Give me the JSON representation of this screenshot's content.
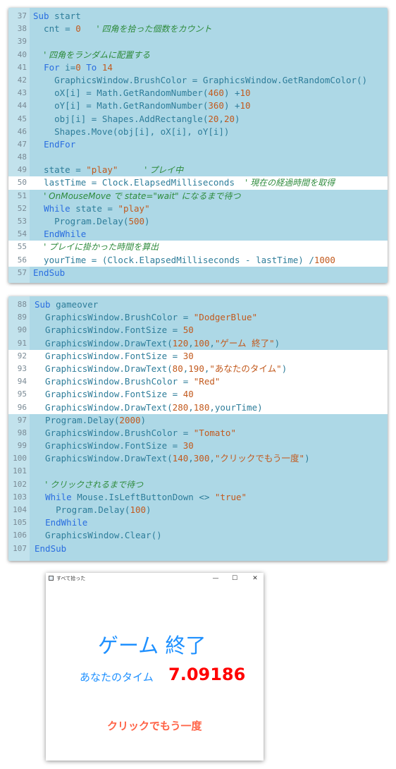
{
  "panel1": {
    "lines": [
      {
        "n": "37",
        "tokens": [
          [
            "kw",
            "Sub"
          ],
          [
            "id",
            " start"
          ]
        ]
      },
      {
        "n": "38",
        "tokens": [
          [
            "id",
            "  cnt = "
          ],
          [
            "num",
            "0"
          ],
          [
            "id",
            "   "
          ],
          [
            "cmt",
            "' 四角を拾った個数をカウント"
          ]
        ]
      },
      {
        "n": "39",
        "tokens": []
      },
      {
        "n": "40",
        "tokens": [
          [
            "id",
            "  "
          ],
          [
            "cmt",
            "' 四角をランダムに配置する"
          ]
        ]
      },
      {
        "n": "41",
        "tokens": [
          [
            "id",
            "  "
          ],
          [
            "kw",
            "For"
          ],
          [
            "id",
            " i="
          ],
          [
            "num",
            "0"
          ],
          [
            "id",
            " "
          ],
          [
            "kw",
            "To"
          ],
          [
            "id",
            " "
          ],
          [
            "num",
            "14"
          ]
        ]
      },
      {
        "n": "42",
        "tokens": [
          [
            "id",
            "    GraphicsWindow.BrushColor = GraphicsWindow.GetRandomColor()"
          ]
        ]
      },
      {
        "n": "43",
        "tokens": [
          [
            "id",
            "    oX[i] = Math.GetRandomNumber("
          ],
          [
            "num",
            "460"
          ],
          [
            "id",
            ") +"
          ],
          [
            "num",
            "10"
          ]
        ]
      },
      {
        "n": "44",
        "tokens": [
          [
            "id",
            "    oY[i] = Math.GetRandomNumber("
          ],
          [
            "num",
            "360"
          ],
          [
            "id",
            ") +"
          ],
          [
            "num",
            "10"
          ]
        ]
      },
      {
        "n": "45",
        "tokens": [
          [
            "id",
            "    obj[i] = Shapes.AddRectangle("
          ],
          [
            "num",
            "20"
          ],
          [
            "id",
            ","
          ],
          [
            "num",
            "20"
          ],
          [
            "id",
            ")"
          ]
        ]
      },
      {
        "n": "46",
        "tokens": [
          [
            "id",
            "    Shapes.Move(obj[i], oX[i], oY[i])"
          ]
        ]
      },
      {
        "n": "47",
        "tokens": [
          [
            "id",
            "  "
          ],
          [
            "kw",
            "EndFor"
          ]
        ]
      },
      {
        "n": "48",
        "tokens": []
      },
      {
        "n": "49",
        "tokens": [
          [
            "id",
            "  state = "
          ],
          [
            "str",
            "\"play\""
          ],
          [
            "id",
            "     "
          ],
          [
            "cmt",
            "' プレイ中"
          ]
        ]
      },
      {
        "n": "50",
        "hl": true,
        "tokens": [
          [
            "id",
            "  lastTime = Clock.ElapsedMilliseconds  "
          ],
          [
            "cmt",
            "' 現在の経過時間を取得"
          ]
        ]
      },
      {
        "n": "51",
        "tokens": [
          [
            "id",
            "  "
          ],
          [
            "cmt",
            "' OnMouseMove で state=\"wait\" になるまで待つ"
          ]
        ]
      },
      {
        "n": "52",
        "tokens": [
          [
            "id",
            "  "
          ],
          [
            "kw",
            "While"
          ],
          [
            "id",
            " state = "
          ],
          [
            "str",
            "\"play\""
          ]
        ]
      },
      {
        "n": "53",
        "tokens": [
          [
            "id",
            "    Program.Delay("
          ],
          [
            "num",
            "500"
          ],
          [
            "id",
            ")"
          ]
        ]
      },
      {
        "n": "54",
        "tokens": [
          [
            "id",
            "  "
          ],
          [
            "kw",
            "EndWhile"
          ]
        ]
      },
      {
        "n": "55",
        "hl": true,
        "tokens": [
          [
            "id",
            "  "
          ],
          [
            "cmt",
            "' プレイに掛かった時間を算出"
          ]
        ]
      },
      {
        "n": "56",
        "hl": true,
        "tokens": [
          [
            "id",
            "  yourTime = (Clock.ElapsedMilliseconds - lastTime) /"
          ],
          [
            "num",
            "1000"
          ]
        ]
      },
      {
        "n": "57",
        "tokens": [
          [
            "kw",
            "EndSub"
          ]
        ]
      }
    ]
  },
  "panel2": {
    "lines": [
      {
        "n": "88",
        "tokens": [
          [
            "kw",
            "Sub"
          ],
          [
            "id",
            " gameover"
          ]
        ]
      },
      {
        "n": "89",
        "tokens": [
          [
            "id",
            "  GraphicsWindow.BrushColor = "
          ],
          [
            "str",
            "\"DodgerBlue\""
          ]
        ]
      },
      {
        "n": "90",
        "tokens": [
          [
            "id",
            "  GraphicsWindow.FontSize = "
          ],
          [
            "num",
            "50"
          ]
        ]
      },
      {
        "n": "91",
        "tokens": [
          [
            "id",
            "  GraphicsWindow.DrawText("
          ],
          [
            "num",
            "120"
          ],
          [
            "id",
            ","
          ],
          [
            "num",
            "100"
          ],
          [
            "id",
            ","
          ],
          [
            "str",
            "\"ゲーム 終了\""
          ],
          [
            "id",
            ")"
          ]
        ]
      },
      {
        "n": "92",
        "hl": true,
        "tokens": [
          [
            "id",
            "  GraphicsWindow.FontSize = "
          ],
          [
            "num",
            "30"
          ]
        ]
      },
      {
        "n": "93",
        "hl": true,
        "tokens": [
          [
            "id",
            "  GraphicsWindow.DrawText("
          ],
          [
            "num",
            "80"
          ],
          [
            "id",
            ","
          ],
          [
            "num",
            "190"
          ],
          [
            "id",
            ","
          ],
          [
            "str",
            "\"あなたのタイム\""
          ],
          [
            "id",
            ")"
          ]
        ]
      },
      {
        "n": "94",
        "hl": true,
        "tokens": [
          [
            "id",
            "  GraphicsWindow.BrushColor = "
          ],
          [
            "str",
            "\"Red\""
          ]
        ]
      },
      {
        "n": "95",
        "hl": true,
        "tokens": [
          [
            "id",
            "  GraphicsWindow.FontSize = "
          ],
          [
            "num",
            "40"
          ]
        ]
      },
      {
        "n": "96",
        "hl": true,
        "tokens": [
          [
            "id",
            "  GraphicsWindow.DrawText("
          ],
          [
            "num",
            "280"
          ],
          [
            "id",
            ","
          ],
          [
            "num",
            "180"
          ],
          [
            "id",
            ",yourTime)"
          ]
        ]
      },
      {
        "n": "97",
        "tokens": [
          [
            "id",
            "  Program.Delay("
          ],
          [
            "num",
            "2000"
          ],
          [
            "id",
            ")"
          ]
        ]
      },
      {
        "n": "98",
        "tokens": [
          [
            "id",
            "  GraphicsWindow.BrushColor = "
          ],
          [
            "str",
            "\"Tomato\""
          ]
        ]
      },
      {
        "n": "99",
        "tokens": [
          [
            "id",
            "  GraphicsWindow.FontSize = "
          ],
          [
            "num",
            "30"
          ]
        ]
      },
      {
        "n": "100",
        "tokens": [
          [
            "id",
            "  GraphicsWindow.DrawText("
          ],
          [
            "num",
            "140"
          ],
          [
            "id",
            ","
          ],
          [
            "num",
            "300"
          ],
          [
            "id",
            ","
          ],
          [
            "str",
            "\"クリックでもう一度\""
          ],
          [
            "id",
            ")"
          ]
        ]
      },
      {
        "n": "101",
        "tokens": []
      },
      {
        "n": "102",
        "tokens": [
          [
            "id",
            "  "
          ],
          [
            "cmt",
            "' クリックされるまで待つ"
          ]
        ]
      },
      {
        "n": "103",
        "tokens": [
          [
            "id",
            "  "
          ],
          [
            "kw",
            "While"
          ],
          [
            "id",
            " Mouse.IsLeftButtonDown <> "
          ],
          [
            "str",
            "\"true\""
          ]
        ]
      },
      {
        "n": "104",
        "tokens": [
          [
            "id",
            "    Program.Delay("
          ],
          [
            "num",
            "100"
          ],
          [
            "id",
            ")"
          ]
        ]
      },
      {
        "n": "105",
        "tokens": [
          [
            "id",
            "  "
          ],
          [
            "kw",
            "EndWhile"
          ]
        ]
      },
      {
        "n": "106",
        "tokens": [
          [
            "id",
            "  GraphicsWindow.Clear()"
          ]
        ]
      },
      {
        "n": "107",
        "tokens": [
          [
            "kw",
            "EndSub"
          ]
        ]
      }
    ]
  },
  "graphics_window": {
    "title": "すべて拾った",
    "min_glyph": "—",
    "max_glyph": "☐",
    "close_glyph": "✕",
    "game_over": "ゲーム 終了",
    "your_time_label": "あなたのタイム",
    "time_value": "7.09186",
    "click_again": "クリックでもう一度"
  },
  "colors": {
    "editor_bg": "#add8e6",
    "highlight": "#ffffff",
    "dodger_blue": "#1e90ff",
    "red": "#ff0000",
    "tomato": "#ff6347"
  }
}
